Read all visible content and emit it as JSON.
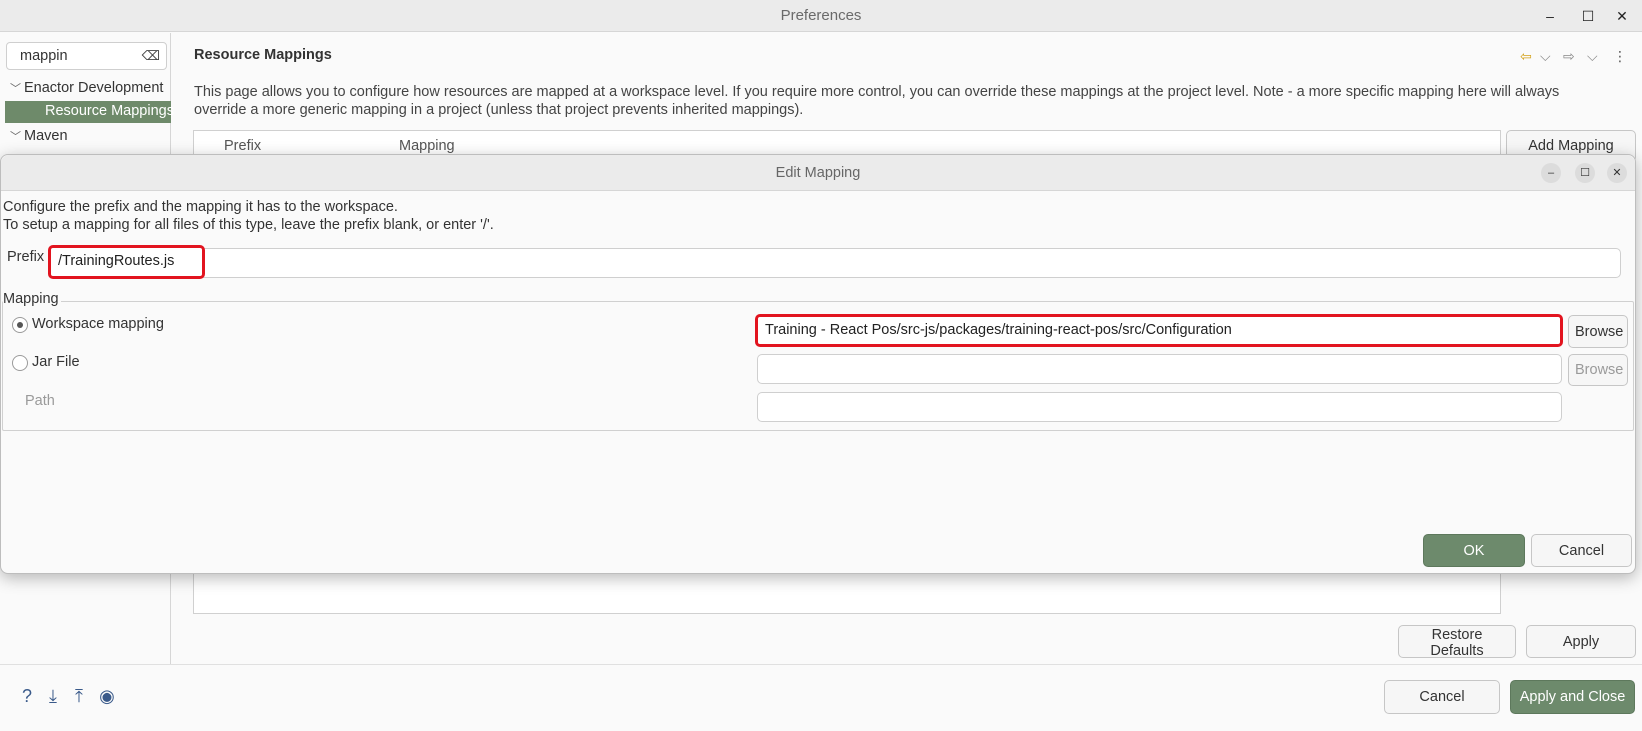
{
  "preferences": {
    "title": "Preferences",
    "filter_value": "mappin",
    "tree": [
      {
        "label": "Enactor Development",
        "expanded": true
      },
      {
        "label": "Resource Mappings",
        "selected": true
      },
      {
        "label": "Maven",
        "expanded": true
      }
    ],
    "page_title": "Resource Mappings",
    "description_line1": "This page allows you to configure how resources are mapped at a workspace level. If you require more control, you can override these mappings at the project level. Note - a more specific mapping here will always",
    "description_line2": "override a more generic mapping in a project (unless that project prevents inherited mappings).",
    "columns": [
      "Prefix",
      "Mapping"
    ],
    "add_mapping_label": "Add Mapping",
    "restore_defaults_label": "Restore Defaults",
    "apply_label": "Apply",
    "cancel_label": "Cancel",
    "apply_close_label": "Apply and Close",
    "footer_icons": [
      "help-icon",
      "import-icon",
      "export-icon",
      "record-icon"
    ]
  },
  "edit_mapping": {
    "title": "Edit Mapping",
    "info_line1": "Configure the prefix and the mapping it has to the workspace.",
    "info_line2": "To setup a mapping for all files of this type, leave the prefix blank, or enter '/'.",
    "prefix_label": "Prefix",
    "prefix_value": "/TrainingRoutes.js",
    "mapping_group_label": "Mapping",
    "workspace_mapping_label": "Workspace mapping",
    "workspace_mapping_selected": true,
    "workspace_path_value": "Training - React Pos/src-js/packages/training-react-pos/src/Configuration",
    "jar_file_label": "Jar File",
    "jar_file_value": "",
    "path_label": "Path",
    "path_value": "",
    "browse_label": "Browse",
    "ok_label": "OK",
    "cancel_label": "Cancel"
  },
  "colors": {
    "accent_green": "#6d8a6c",
    "highlight_red": "#e2141f"
  }
}
